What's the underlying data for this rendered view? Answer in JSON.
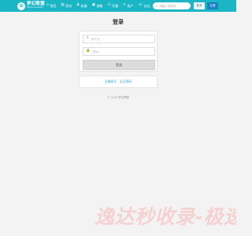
{
  "navbar": {
    "logo": {
      "title": "梦幻联盟",
      "subtitle": "DREAM ALLIANCE",
      "mark": "✿"
    },
    "items": [
      {
        "icon": "⌂",
        "icon_name": "home-icon",
        "label": "首页"
      },
      {
        "icon": "▤",
        "icon_name": "doc-icon",
        "label": "资讯"
      },
      {
        "icon": "♟",
        "icon_name": "game-icon",
        "label": "私服"
      },
      {
        "icon": "▣",
        "icon_name": "book-icon",
        "label": "攻略"
      },
      {
        "icon": "☷",
        "icon_name": "list-icon",
        "label": "开服"
      },
      {
        "icon": "♙",
        "icon_name": "user-icon",
        "label": "用户"
      },
      {
        "icon": "☏",
        "icon_name": "forum-icon",
        "label": "论坛"
      }
    ],
    "search": {
      "icon": "⌕",
      "placeholder": "请输入关键词"
    },
    "login_button": "登录",
    "register_button": "注册"
  },
  "login": {
    "title": "登录",
    "username": {
      "icon": "♙",
      "placeholder": "用户名"
    },
    "password": {
      "icon": "🔒",
      "placeholder": "密码"
    },
    "submit": "登录"
  },
  "links": {
    "register": "注册账号",
    "forgot": "忘记密码"
  },
  "footer": {
    "copyright": "© 2025 梦幻联盟"
  },
  "watermark": {
    "text": "逸达秒收录-极速"
  },
  "colors": {
    "navbar": "#1bb6c6",
    "register_button": "#1683c3",
    "link": "#3a9fd6",
    "page_bg": "#f3f3f3"
  }
}
